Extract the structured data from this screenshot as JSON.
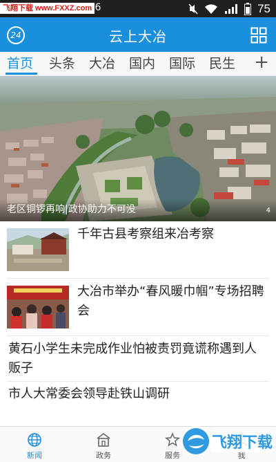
{
  "statusbar": {
    "time": "11:26",
    "watermark": "飞翔下载 www.FXXZ.com",
    "battery": "75",
    "icons": [
      "mute-icon",
      "wifi-icon",
      "signal-icon",
      "battery-icon"
    ]
  },
  "appbar": {
    "badge": "24",
    "title": "云上大冶",
    "menu_icon": "grid-icon"
  },
  "tabs": [
    {
      "label": "首页",
      "active": true
    },
    {
      "label": "头条"
    },
    {
      "label": "大冶"
    },
    {
      "label": "国内"
    },
    {
      "label": "国际"
    },
    {
      "label": "民生"
    }
  ],
  "tabs_more": "+",
  "hero": {
    "caption": "老区铜锣再响|政协助力不可没",
    "page_indicator": "4"
  },
  "news": [
    {
      "title": "千年古县考察组来冶考察",
      "has_thumb": true
    },
    {
      "title": "大冶市举办“春风暖巾帼”专场招聘会",
      "has_thumb": true
    },
    {
      "title": "黄石小学生未完成作业怕被责罚竟谎称遇到人贩子",
      "has_thumb": false
    },
    {
      "title": "市人大常委会领导赴铁山调研",
      "has_thumb": false
    }
  ],
  "bottom_nav": [
    {
      "label": "新闻",
      "icon": "globe-icon",
      "active": true
    },
    {
      "label": "政务",
      "icon": "building-icon"
    },
    {
      "label": "服务",
      "icon": "service-icon"
    },
    {
      "label": "我",
      "icon": "user-icon"
    }
  ],
  "corner_logo": "飞翔下载",
  "colors": {
    "accent": "#1a8fde",
    "watermark_red": "#d4201a"
  }
}
